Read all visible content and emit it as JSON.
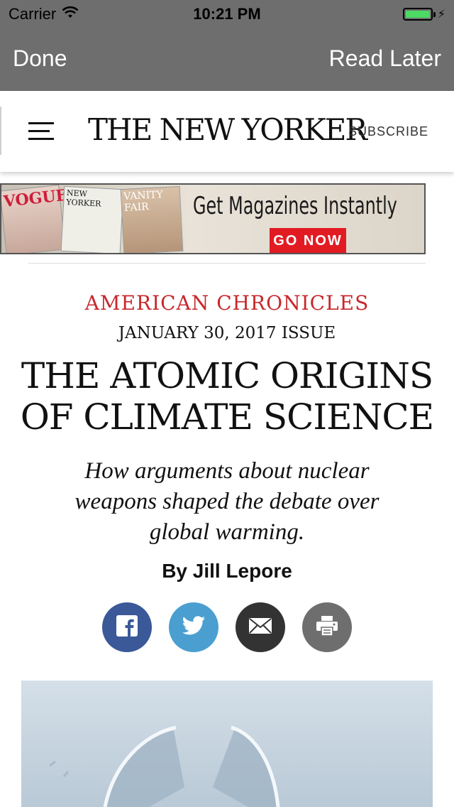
{
  "status_bar": {
    "carrier": "Carrier",
    "time": "10:21 PM",
    "battery_color": "#4cd964"
  },
  "nav": {
    "done": "Done",
    "read_later": "Read Later"
  },
  "header": {
    "logo": "THE NEW YORKER",
    "subscribe": "SUBSCRIBE"
  },
  "ad": {
    "magazines": [
      "VOGUE",
      "NEW YORKER",
      "VANITY FAIR"
    ],
    "headline": "Get Magazines Instantly",
    "cta": "GO NOW",
    "cta_color": "#e21b23"
  },
  "article": {
    "rubric": "AMERICAN CHRONICLES",
    "issue": "JANUARY 30, 2017 ISSUE",
    "headline": "THE ATOMIC ORIGINS OF CLIMATE SCIENCE",
    "dek": "How arguments about nuclear weapons shaped the debate over global warming.",
    "byline_prefix": "By",
    "author": "Jill Lepore",
    "rubric_color": "#c7282d"
  },
  "share": {
    "facebook_color": "#3b5998",
    "twitter_color": "#4a9fd0",
    "email_color": "#333333",
    "print_color": "#6e6e6e"
  }
}
